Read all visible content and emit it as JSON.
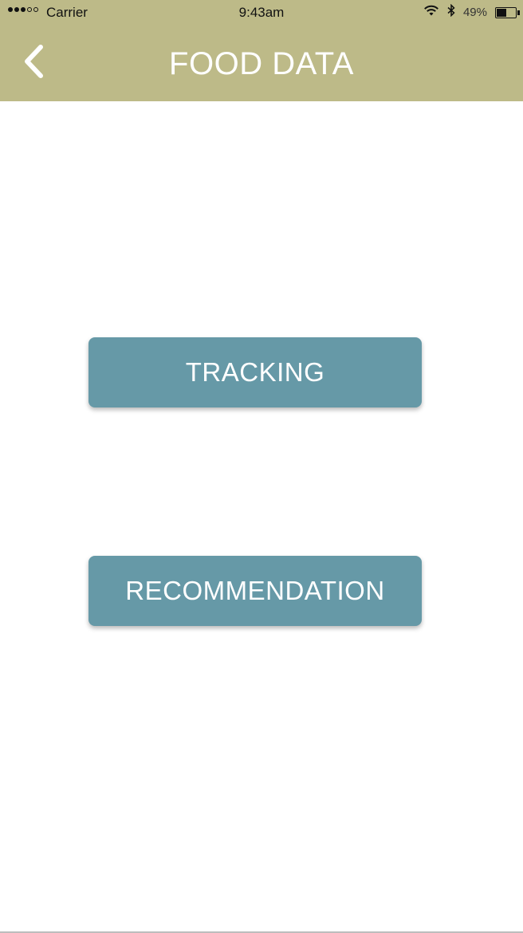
{
  "status_bar": {
    "carrier": "Carrier",
    "time": "9:43am",
    "battery_percent": "49%",
    "signal_bars_filled": 3,
    "signal_bars_total": 5
  },
  "header": {
    "title": "FOOD DATA",
    "back_icon": "chevron-left-icon",
    "background_color": "#bdba88"
  },
  "main": {
    "tracking_label": "TRACKING",
    "recommendation_label": "RECOMMENDATION",
    "button_color": "#6699a7"
  }
}
